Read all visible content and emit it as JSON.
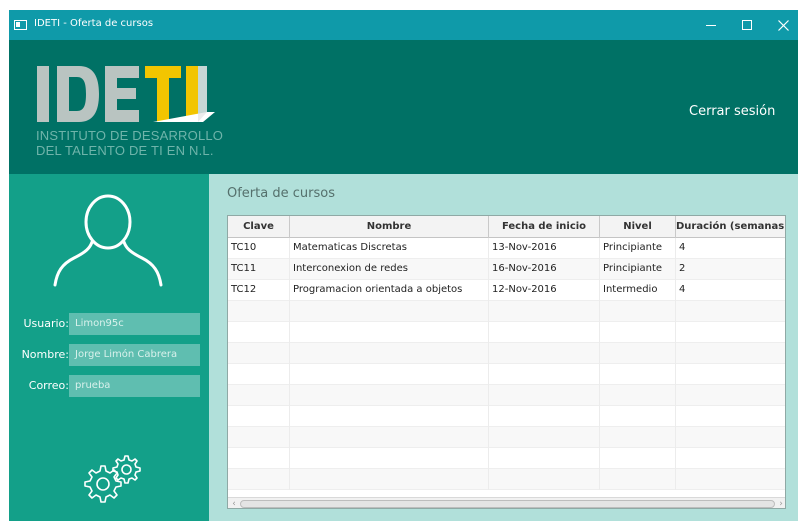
{
  "window": {
    "title": "IDETI - Oferta de cursos",
    "minimize_glyph": "",
    "close_glyph": "✕"
  },
  "header": {
    "logo_text": "IDETI",
    "logo_line1": "INSTITUTO DE DESARROLLO",
    "logo_line2": "DEL TALENTO DE TI EN N.L.",
    "logout_label": "Cerrar sesión"
  },
  "sidebar": {
    "avatar_icon": "user-silhouette-icon",
    "fields": [
      {
        "label": "Usuario:",
        "value": "Limon95c"
      },
      {
        "label": "Nombre:",
        "value": "Jorge Limón Cabrera"
      },
      {
        "label": "Correo:",
        "value": "prueba"
      }
    ],
    "settings_icon": "gears-icon"
  },
  "content": {
    "title": "Oferta de cursos",
    "table": {
      "columns": [
        "Clave",
        "Nombre",
        "Fecha de inicio",
        "Nivel",
        "Duración (semanas)"
      ],
      "rows": [
        [
          "TC10",
          "Matematicas Discretas",
          "13-Nov-2016",
          "Principiante",
          "4"
        ],
        [
          "TC11",
          "Interconexion de redes",
          "16-Nov-2016",
          "Principiante",
          "2"
        ],
        [
          "TC12",
          "Programacion orientada a objetos",
          "12-Nov-2016",
          "Intermedio",
          "4"
        ]
      ],
      "scroll_left": "‹",
      "scroll_right": "›"
    }
  },
  "colors": {
    "titlebar": "#0f9aa9",
    "header": "#007165",
    "sidebar": "#13a089",
    "content": "#b1e0da",
    "logo_gray": "#b9c4c1",
    "logo_yellow": "#f2c500"
  }
}
